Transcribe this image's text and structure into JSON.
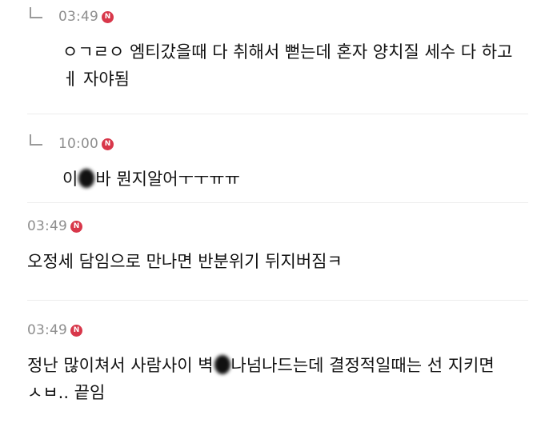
{
  "comments": [
    {
      "reply": true,
      "time": "03:49",
      "badge": "N",
      "text": "ㅇㄱㄹㅇ 엠티갔을때 다 취해서 뻗는데 혼자 양치질 세수 다 하고 ㅔ 자야됨"
    },
    {
      "reply": true,
      "time": "10:00",
      "badge": "N",
      "text_before": "이",
      "text_after": "바 뭔지알어ㅜㅜㅠㅠ"
    },
    {
      "reply": false,
      "time": "03:49",
      "badge": "N",
      "text": "오정세 담임으로 만나면 반분위기 뒤지버짐ㅋ"
    },
    {
      "reply": false,
      "time": "03:49",
      "badge": "N",
      "text_before": "정난 많이쳐서 사람사이 벽",
      "text_after": "나넘나드는데 결정적일때는 선 지키면 ㅅㅂ.. 끝임"
    }
  ],
  "colors": {
    "time": "#8e8e8e",
    "badge": "#d8374a",
    "divider": "#ececec"
  }
}
